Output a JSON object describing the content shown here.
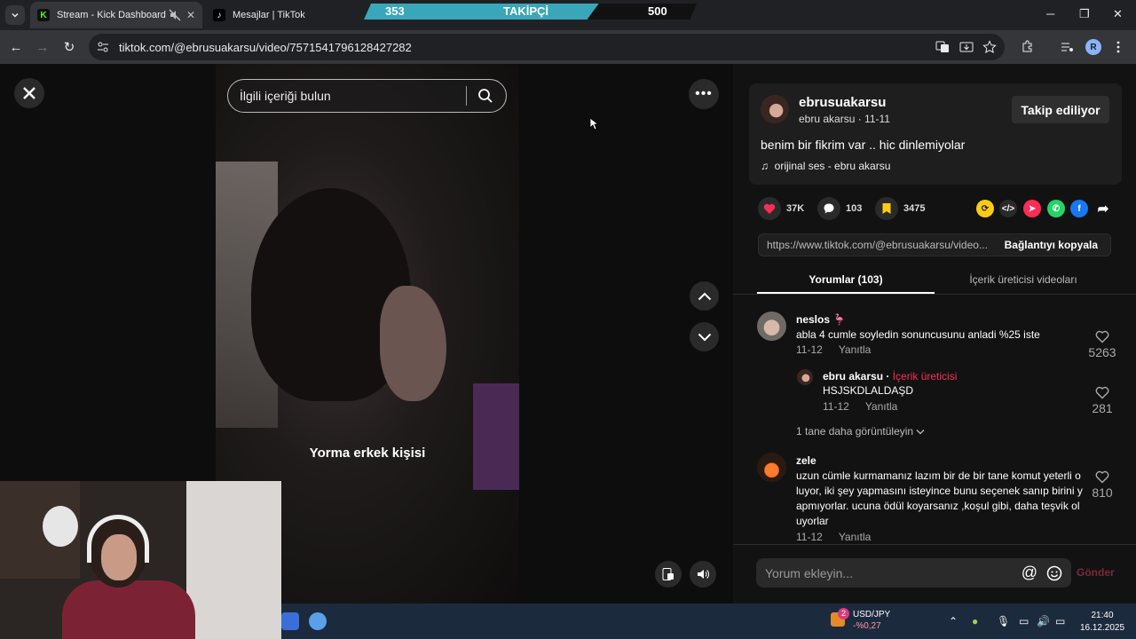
{
  "browser": {
    "tabs": [
      {
        "title": "Stream - Kick Dashboard"
      },
      {
        "title": "Mesajlar | TikTok"
      }
    ],
    "url": "tiktok.com/@ebrusuakarsu/video/7571541796128427282",
    "profile_initial": "R"
  },
  "overlay": {
    "current": "353",
    "label": "TAKİPÇİ",
    "goal": "500",
    "progress": 0.706,
    "fill_color": "#3aa6b9"
  },
  "video": {
    "search_placeholder": "İlgili içeriği bulun",
    "caption": "Yorma erkek kişisi"
  },
  "post": {
    "username": "ebrusuakarsu",
    "display_name": "ebru akarsu",
    "date": "11-11",
    "follow_label": "Takip ediliyor",
    "description": "benim bir fikrim var .. hic dinlemiyolar",
    "music": "orijinal ses - ebru akarsu",
    "likes": "37K",
    "comments": "103",
    "saves": "3475",
    "link": "https://www.tiktok.com/@ebrusuakarsu/video...",
    "copy_label": "Bağlantıyı kopyala"
  },
  "tabs": {
    "comments": "Yorumlar (103)",
    "creator_videos": "İçerik üreticisi videoları"
  },
  "comments": [
    {
      "name": "neslos 🦩",
      "text": "abla 4 cumle soyledin sonuncusunu anladi %25 iste",
      "date": "11-12",
      "reply": "Yanıtla",
      "likes": "5263"
    },
    {
      "name": "ebru akarsu · ",
      "creator": "İçerik üreticisi",
      "text": "HSJSKDLALDAŞD",
      "date": "11-12",
      "reply": "Yanıtla",
      "likes": "281"
    },
    {
      "name": "zele",
      "text": "uzun cümle kurmamanız lazım bir de bir tane komut yeterli o luyor, iki şey yapmasını isteyince bunu seçenek sanıp birini y apmıyorlar. ucuna ödül koyarsanız ,koşul gibi, daha teşvik ol uyorlar",
      "date": "11-12",
      "reply": "Yanıtla",
      "likes": "810"
    }
  ],
  "more_replies": "1 tane daha görüntüleyin",
  "comment_box": {
    "placeholder": "Yorum ekleyin...",
    "send": "Gönder"
  },
  "taskbar": {
    "ticker": "USD/JPY",
    "change": "-%0,27",
    "badge": "2",
    "time": "21:40",
    "date": "16.12.2025"
  }
}
